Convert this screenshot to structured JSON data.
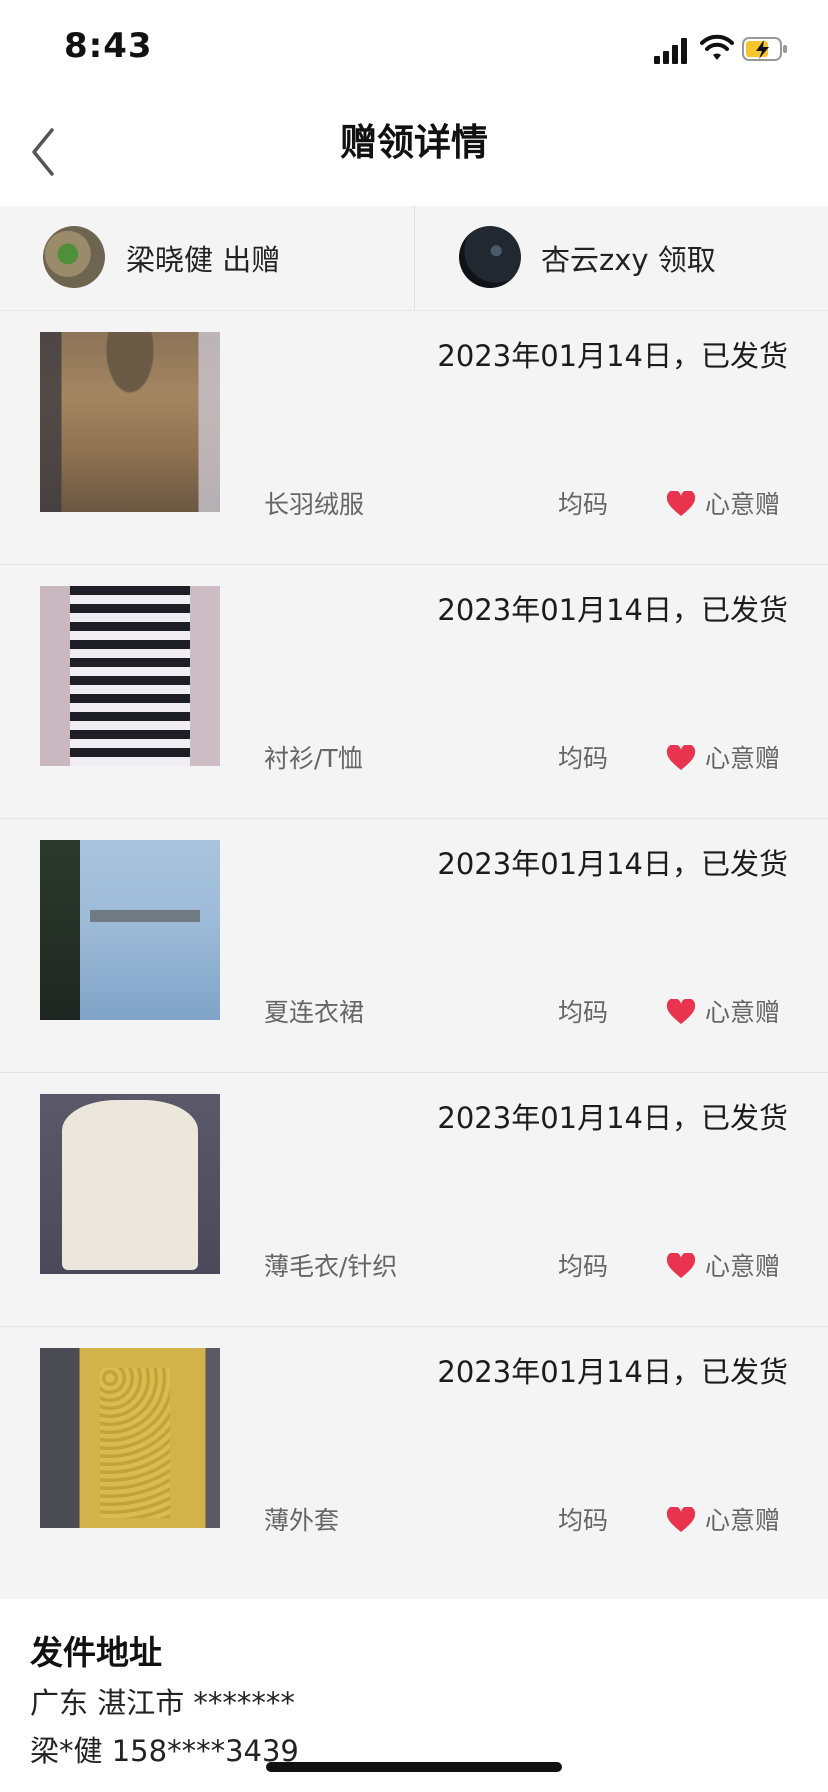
{
  "status_bar": {
    "time": "8:43"
  },
  "header": {
    "title": "赠领详情",
    "back_icon": "chevron-left-icon"
  },
  "participants": {
    "giver": {
      "label": "梁晓健 出赠"
    },
    "receiver": {
      "label": "杏云zxy 领取"
    }
  },
  "items": [
    {
      "name": "长羽绒服",
      "date": "2023年01月14日，已发货",
      "size": "均码",
      "tag": "心意赠"
    },
    {
      "name": "衬衫/T恤",
      "date": "2023年01月14日，已发货",
      "size": "均码",
      "tag": "心意赠"
    },
    {
      "name": "夏连衣裙",
      "date": "2023年01月14日，已发货",
      "size": "均码",
      "tag": "心意赠"
    },
    {
      "name": "薄毛衣/针织",
      "date": "2023年01月14日，已发货",
      "size": "均码",
      "tag": "心意赠"
    },
    {
      "name": "薄外套",
      "date": "2023年01月14日，已发货",
      "size": "均码",
      "tag": "心意赠"
    }
  ],
  "address": {
    "title": "发件地址",
    "line": "广东 湛江市 *******",
    "contact": "梁*健 158****3439"
  },
  "colors": {
    "heart": "#e8344e",
    "background": "#f4f4f4"
  }
}
